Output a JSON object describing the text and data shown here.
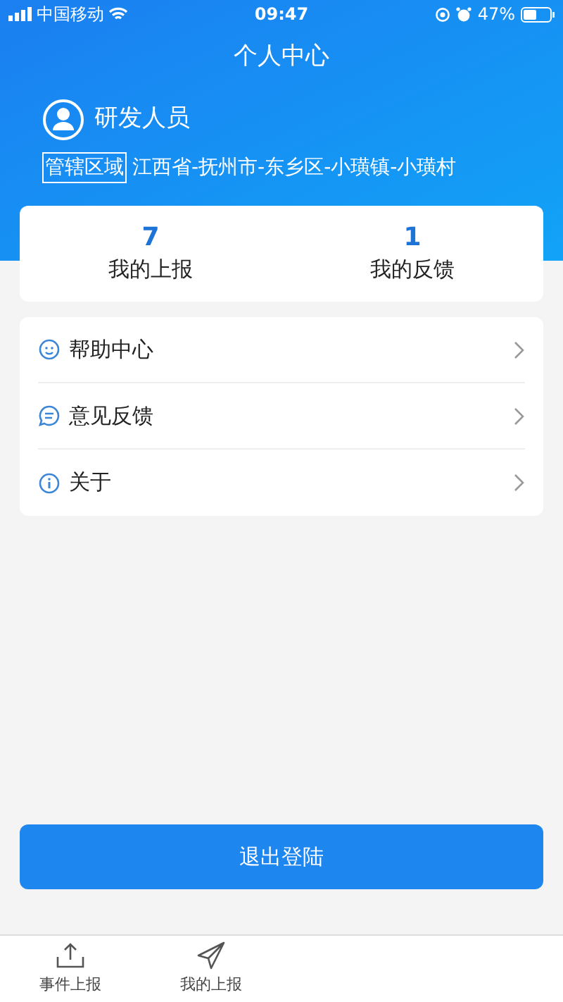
{
  "status_bar": {
    "carrier": "中国移动",
    "time": "09:47",
    "battery": "47%"
  },
  "header": {
    "title": "个人中心"
  },
  "user": {
    "name": "研发人员",
    "region_label": "管辖区域",
    "region": "江西省-抚州市-东乡区-小璜镇-小璜村"
  },
  "stats": [
    {
      "value": "7",
      "label": "我的上报"
    },
    {
      "value": "1",
      "label": "我的反馈"
    }
  ],
  "menu": [
    {
      "kind": "help",
      "label": "帮助中心"
    },
    {
      "kind": "feedback",
      "label": "意见反馈"
    },
    {
      "kind": "about",
      "label": "关于"
    }
  ],
  "logout_button": "退出登陆",
  "tab_bar": [
    {
      "kind": "upload",
      "label": "事件上报"
    },
    {
      "kind": "send",
      "label": "我的上报"
    }
  ]
}
